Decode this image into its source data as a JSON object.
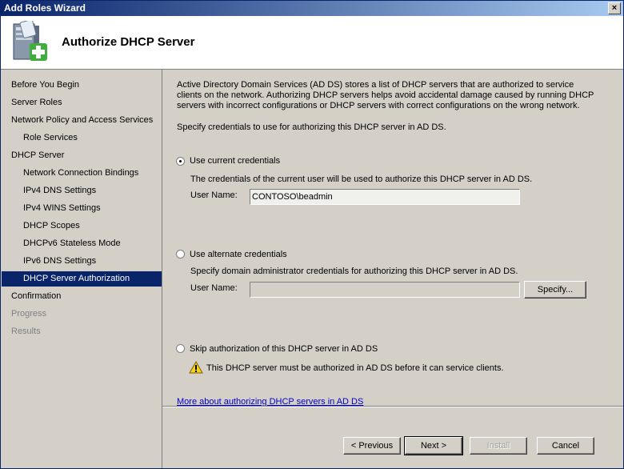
{
  "window": {
    "title": "Add Roles Wizard",
    "close": "×"
  },
  "header": {
    "title": "Authorize DHCP Server"
  },
  "nav": {
    "items": [
      {
        "label": "Before You Begin"
      },
      {
        "label": "Server Roles"
      },
      {
        "label": "Network Policy and Access Services"
      },
      {
        "label": "Role Services"
      },
      {
        "label": "DHCP Server"
      },
      {
        "label": "Network Connection Bindings"
      },
      {
        "label": "IPv4 DNS Settings"
      },
      {
        "label": "IPv4 WINS Settings"
      },
      {
        "label": "DHCP Scopes"
      },
      {
        "label": "DHCPv6 Stateless Mode"
      },
      {
        "label": "IPv6 DNS Settings"
      },
      {
        "label": "DHCP Server Authorization"
      },
      {
        "label": "Confirmation"
      },
      {
        "label": "Progress"
      },
      {
        "label": "Results"
      }
    ]
  },
  "content": {
    "intro_line1": "Active Directory Domain Services (AD DS) stores a list of DHCP servers that are authorized to service",
    "intro_line2": "clients on the network. Authorizing DHCP servers helps avoid accidental damage caused by running DHCP",
    "intro_line3": "servers with incorrect configurations or DHCP servers with correct configurations on the wrong network.",
    "specify": "Specify credentials to use for authorizing this DHCP server in AD DS.",
    "current": {
      "label": "Use current credentials",
      "desc": "The credentials of the current user will be used to authorize this DHCP server in AD DS.",
      "username_label": "User Name:",
      "username_value": "CONTOSO\\beadmin"
    },
    "alternate": {
      "label": "Use alternate credentials",
      "desc": "Specify domain administrator credentials for authorizing this DHCP server in AD DS.",
      "username_label": "User Name:",
      "username_value": "",
      "specify_button": "Specify..."
    },
    "skip": {
      "label": "Skip authorization of this DHCP server in AD DS",
      "warning": "This DHCP server must be authorized in AD DS before it can service clients."
    },
    "more_link": "More about authorizing DHCP servers in AD DS"
  },
  "buttons": {
    "previous": "< Previous",
    "next": "Next >",
    "install": "Install",
    "cancel": "Cancel"
  }
}
